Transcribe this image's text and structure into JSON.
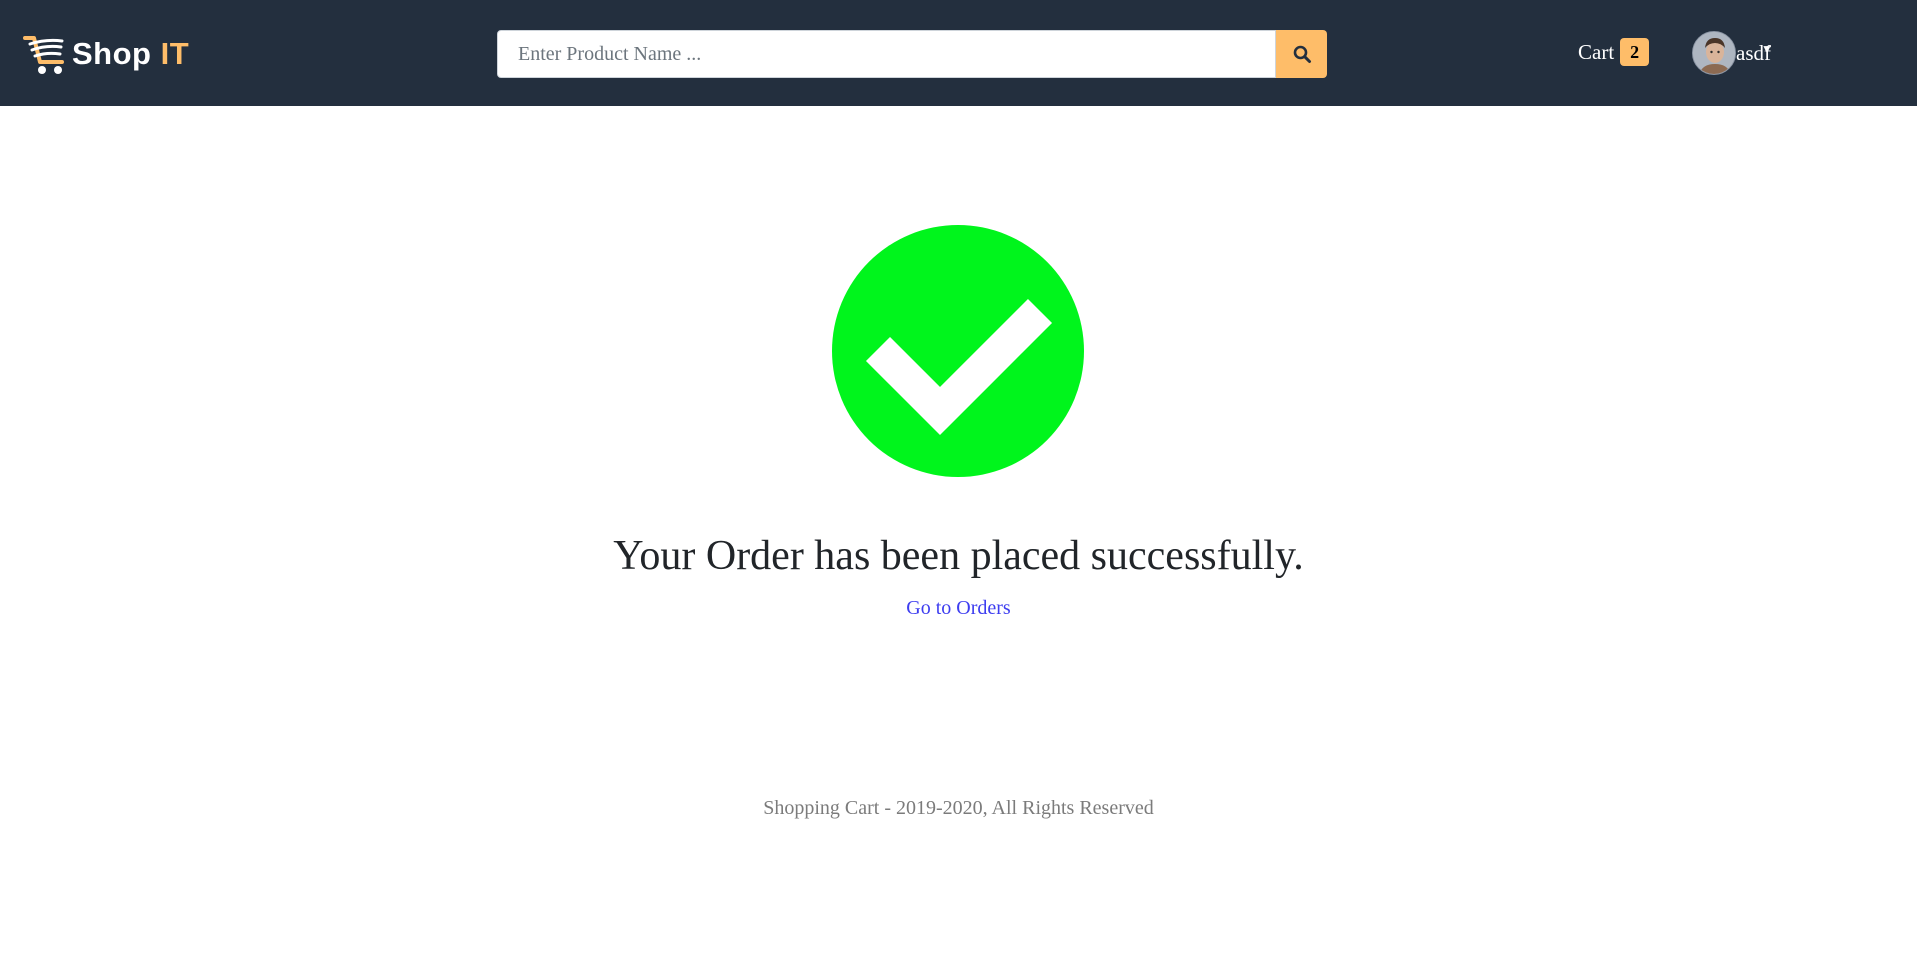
{
  "header": {
    "logo": {
      "text_main": "Shop",
      "text_accent": "IT",
      "icon": "shopping-cart-icon"
    },
    "search": {
      "placeholder": "Enter Product Name ...",
      "value": "",
      "button_icon": "search-icon"
    },
    "cart": {
      "label": "Cart",
      "count": "2"
    },
    "user": {
      "name": "asdf",
      "avatar_icon": "user-avatar",
      "caret_icon": "caret-down-icon"
    }
  },
  "main": {
    "status_icon": "check-circle-icon",
    "message": "Your Order has been placed successfully.",
    "link_label": "Go to Orders"
  },
  "footer": {
    "text": "Shopping Cart - 2019-2020, All Rights Reserved"
  },
  "colors": {
    "navbar_bg": "#232f3e",
    "accent": "#febd69",
    "success": "#00f51c",
    "link": "#3d3df0"
  }
}
